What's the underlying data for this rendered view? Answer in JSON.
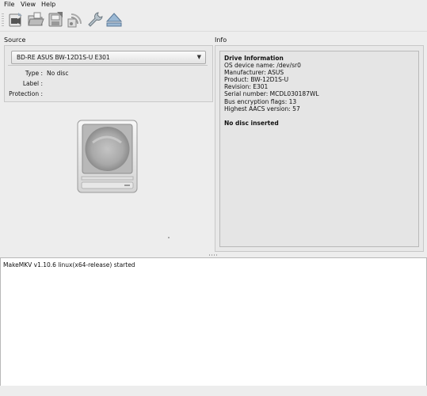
{
  "menu": {
    "file": "File",
    "view": "View",
    "help": "Help"
  },
  "toolbar": {
    "buttons": [
      {
        "icon": "make-mkv-icon"
      },
      {
        "icon": "open-files-icon"
      },
      {
        "icon": "backup-icon"
      },
      {
        "icon": "stream-icon"
      },
      {
        "icon": "settings-wrench-icon"
      },
      {
        "icon": "eject-icon"
      }
    ]
  },
  "source": {
    "title": "Source",
    "drive_selected": "BD-RE ASUS BW-12D1S-U E301",
    "type_label": "Type :",
    "type_value": "No disc",
    "label_label": "Label :",
    "label_value": "",
    "protection_label": "Protection :",
    "protection_value": ""
  },
  "info": {
    "title": "Info",
    "heading": "Drive Information",
    "lines": [
      "OS device name: /dev/sr0",
      "Manufacturer: ASUS",
      "Product: BW-12D1S-U",
      "Revision: E301",
      "Serial number: MCDL030187WL",
      "Bus encryption flags: 13",
      "Highest AACS version: 57"
    ],
    "status": "No disc inserted"
  },
  "log": {
    "lines": [
      "MakeMKV v1.10.6 linux(x64-release) started"
    ]
  },
  "colors": {
    "window_bg": "#ededed",
    "log_bg": "#ffffff",
    "panel_border": "#c8c8c8"
  }
}
